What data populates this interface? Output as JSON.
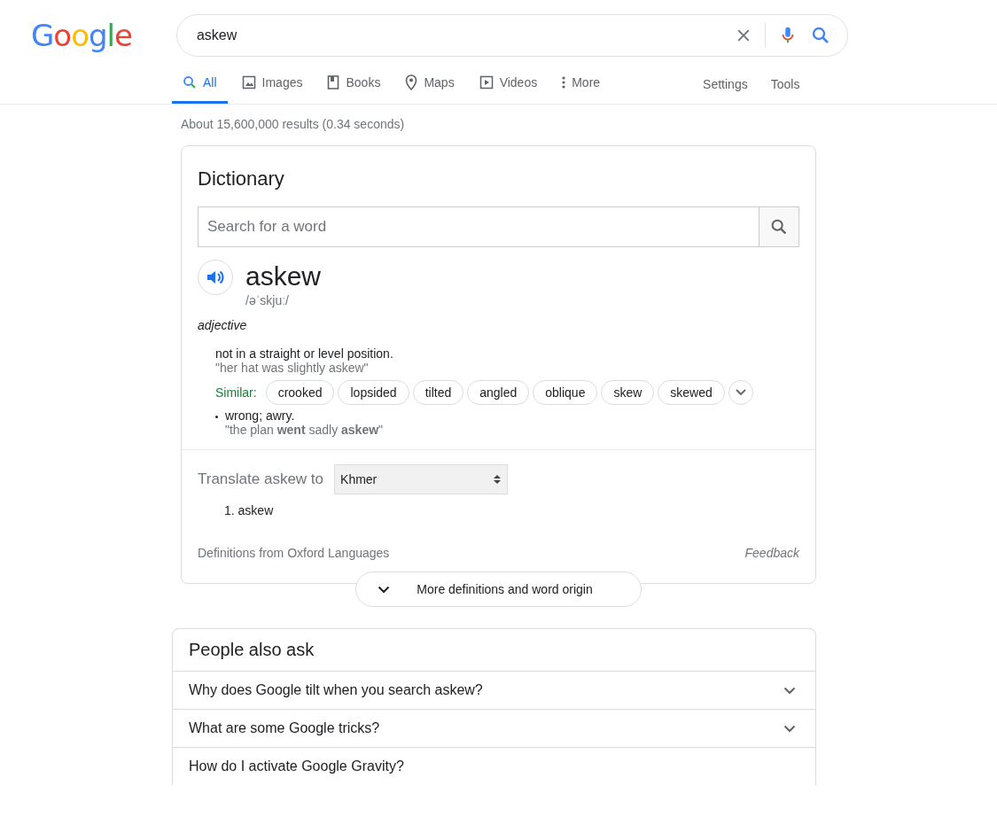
{
  "logo": "Google",
  "search": {
    "value": "askew"
  },
  "tabs": [
    {
      "label": "All",
      "kind": "search",
      "selected": true
    },
    {
      "label": "Images",
      "kind": "image",
      "selected": false
    },
    {
      "label": "Books",
      "kind": "book",
      "selected": false
    },
    {
      "label": "Maps",
      "kind": "pin",
      "selected": false
    },
    {
      "label": "Videos",
      "kind": "play",
      "selected": false
    },
    {
      "label": "More",
      "kind": "dots",
      "selected": false
    }
  ],
  "tools": [
    "Settings",
    "Tools"
  ],
  "result_stats": "About 15,600,000 results (0.34 seconds)",
  "dictionary": {
    "title": "Dictionary",
    "search_placeholder": "Search for a word",
    "word": "askew",
    "phonetic": "/əˈskjuː/",
    "part_of_speech": "adjective",
    "senses": [
      {
        "definition": "not in a straight or level position.",
        "example": "\"her hat was slightly askew\"",
        "similar_label": "Similar:",
        "similar": [
          "crooked",
          "lopsided",
          "tilted",
          "angled",
          "oblique",
          "skew",
          "skewed"
        ]
      },
      {
        "definition": "wrong; awry.",
        "example": "\"the plan **went** sadly **askew**\""
      }
    ],
    "translate_label": "Translate askew to",
    "language": "Khmer",
    "translations": [
      "1. askew"
    ],
    "source": "Definitions from Oxford Languages",
    "feedback": "Feedback",
    "more_button": "More definitions and word origin"
  },
  "people_also_ask": {
    "title": "People also ask",
    "questions": [
      "Why does Google tilt when you search askew?",
      "What are some Google tricks?",
      "How do I activate Google Gravity?"
    ]
  }
}
